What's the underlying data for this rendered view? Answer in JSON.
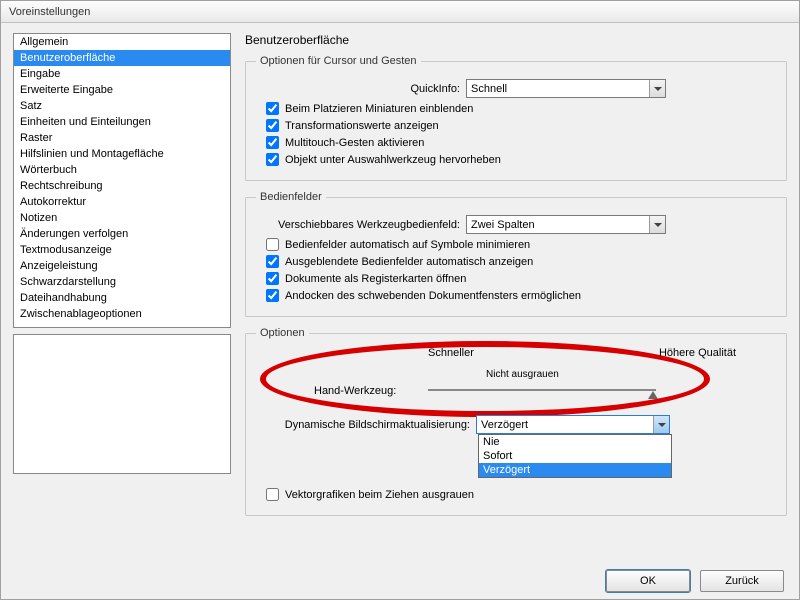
{
  "title": "Voreinstellungen",
  "sidebar": {
    "items": [
      "Allgemein",
      "Benutzeroberfläche",
      "Eingabe",
      "Erweiterte Eingabe",
      "Satz",
      "Einheiten und Einteilungen",
      "Raster",
      "Hilfslinien und Montagefläche",
      "Wörterbuch",
      "Rechtschreibung",
      "Autokorrektur",
      "Notizen",
      "Änderungen verfolgen",
      "Textmodusanzeige",
      "Anzeigeleistung",
      "Schwarzdarstellung",
      "Dateihandhabung",
      "Zwischenablageoptionen"
    ],
    "selected_index": 1
  },
  "heading": "Benutzeroberfläche",
  "group1": {
    "legend": "Optionen für Cursor und Gesten",
    "quickinfo_label": "QuickInfo:",
    "quickinfo_value": "Schnell",
    "chk1": "Beim Platzieren Miniaturen einblenden",
    "chk2": "Transformationswerte anzeigen",
    "chk3": "Multitouch-Gesten aktivieren",
    "chk4": "Objekt unter Auswahlwerkzeug hervorheben"
  },
  "group2": {
    "legend": "Bedienfelder",
    "combo_label": "Verschiebbares Werkzeugbedienfeld:",
    "combo_value": "Zwei Spalten",
    "chk1": "Bedienfelder automatisch auf Symbole minimieren",
    "chk2": "Ausgeblendete Bedienfelder automatisch anzeigen",
    "chk3": "Dokumente als Registerkarten öffnen",
    "chk4": "Andocken des schwebenden Dokumentfensters ermöglichen"
  },
  "group3": {
    "legend": "Optionen",
    "slider_left": "Schneller",
    "slider_right": "Höhere Qualität",
    "slider_sub": "Nicht ausgrauen",
    "slider_label": "Hand-Werkzeug:",
    "dyn_label": "Dynamische Bildschirmaktualisierung:",
    "dyn_value": "Verzögert",
    "dyn_options": [
      "Nie",
      "Sofort",
      "Verzögert"
    ],
    "dyn_highlight": 2,
    "chk_vector": "Vektorgrafiken beim Ziehen ausgrauen"
  },
  "buttons": {
    "ok": "OK",
    "back": "Zurück"
  }
}
